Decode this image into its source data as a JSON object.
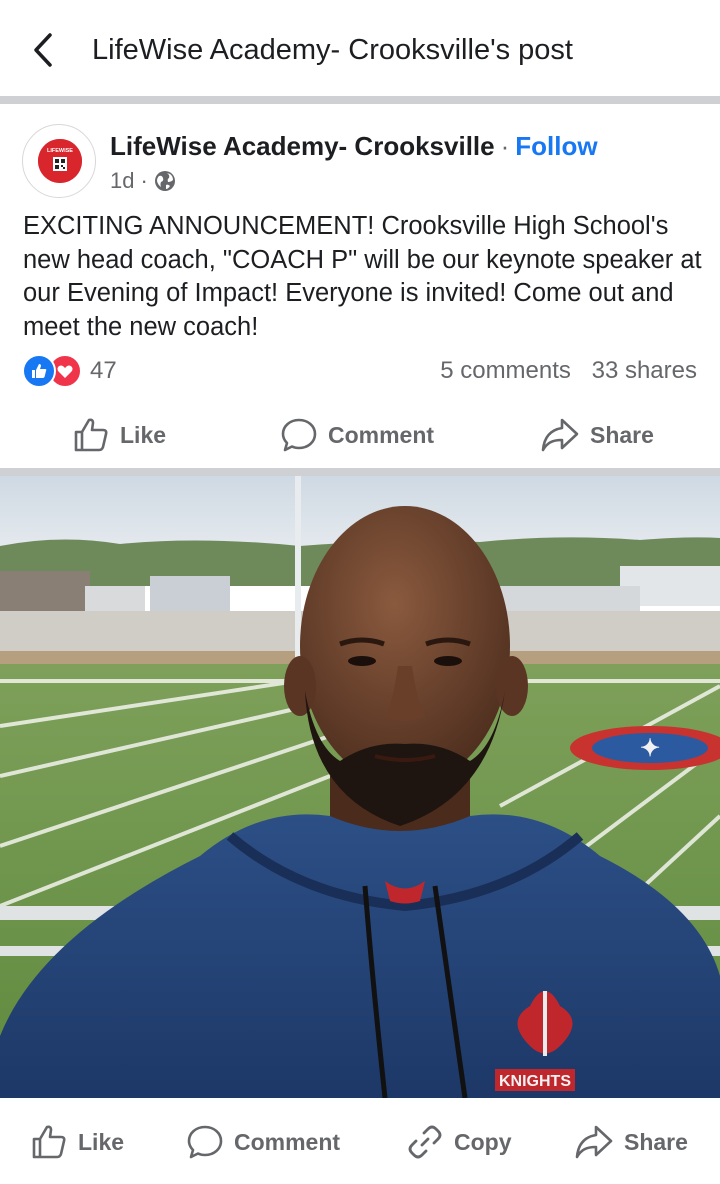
{
  "header": {
    "title": "LifeWise Academy- Crooksville's post",
    "back_icon": "chevron-left-icon"
  },
  "post": {
    "author": "LifeWise Academy- Crooksville",
    "separator": "·",
    "follow_label": "Follow",
    "time": "1d",
    "time_separator": "·",
    "audience_icon": "globe-icon",
    "avatar_text": "LIFEWISE",
    "text": "EXCITING ANNOUNCEMENT! Crooksville High School's new head coach, \"COACH P\" will be our keynote speaker at our Evening of Impact! Everyone is invited! Come out and meet the new coach!",
    "reactions": {
      "icons": [
        "like-reaction-icon",
        "love-reaction-icon"
      ],
      "count": "47"
    },
    "comments_count": "5 comments",
    "shares_count": "33 shares",
    "actions": {
      "like": "Like",
      "comment": "Comment",
      "share": "Share"
    }
  },
  "photo": {
    "hoodie_text": "KNIGHTS"
  },
  "bottom_bar": {
    "like": "Like",
    "comment": "Comment",
    "copy": "Copy",
    "share": "Share"
  },
  "colors": {
    "accent": "#1877f2",
    "love": "#f0354b",
    "muted_text": "#65676b",
    "separator": "#cfd0d3"
  }
}
